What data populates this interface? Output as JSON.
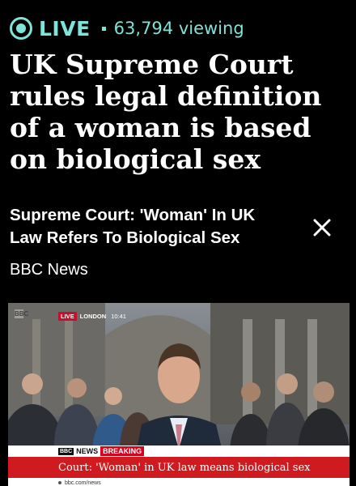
{
  "live": {
    "label": "LIVE",
    "viewers": "63,794 viewing",
    "accent_color": "#7fe3d9",
    "icon": "live-indicator-icon"
  },
  "headline": "UK Supreme Court rules legal definition of a woman is based on biological sex",
  "card": {
    "title": "Supreme Court: 'Woman' In UK Law Refers To Biological Sex",
    "source": "BBC News",
    "close_icon": "close-icon"
  },
  "video": {
    "channel_bug": "BBC",
    "live_tag": "LIVE",
    "location": "LONDON",
    "time": "10:41",
    "lower_third": {
      "brand": "BBC",
      "news_label": "NEWS",
      "breaking_label": "BREAKING",
      "caption": "Court: 'Woman' in UK law means biological sex",
      "url": "bbc.com/news",
      "bar_color": "#cf1a1f"
    }
  }
}
